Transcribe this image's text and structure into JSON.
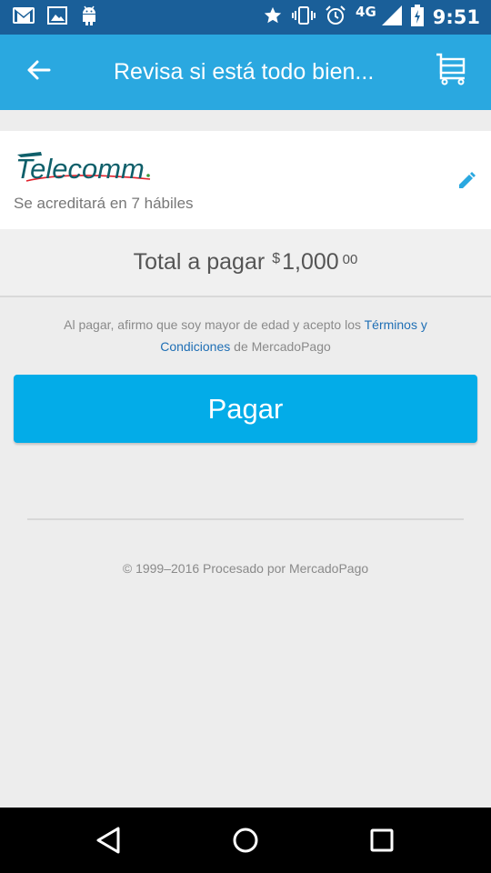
{
  "status_bar": {
    "time": "9:51",
    "network": "4G",
    "icons": [
      "gmail-icon",
      "image-icon",
      "android-icon",
      "star-icon",
      "vibrate-icon",
      "alarm-icon",
      "signal-icon",
      "battery-charging-icon"
    ]
  },
  "app_bar": {
    "title": "Revisa si está todo bien...",
    "back_icon": "arrow-left-icon",
    "cart_icon": "cart-icon",
    "color": "#2aa8e0"
  },
  "merchant": {
    "name": "Telecomm",
    "subtitle": "Se acreditará en 7 hábiles",
    "edit_icon": "pencil-icon"
  },
  "total": {
    "label": "Total a pagar",
    "currency": "$",
    "amount": "1,000",
    "cents": "00"
  },
  "terms": {
    "prefix": "Al pagar, afirmo que soy mayor de edad y acepto los ",
    "link": "Términos y Condiciones",
    "suffix": " de MercadoPago"
  },
  "pay_button": {
    "label": "Pagar",
    "color": "#03ace8"
  },
  "footer": {
    "text": "© 1999–2016 Procesado por MercadoPago"
  },
  "nav_bar": {
    "icons": [
      "back-triangle-icon",
      "home-circle-icon",
      "recents-square-icon"
    ]
  }
}
